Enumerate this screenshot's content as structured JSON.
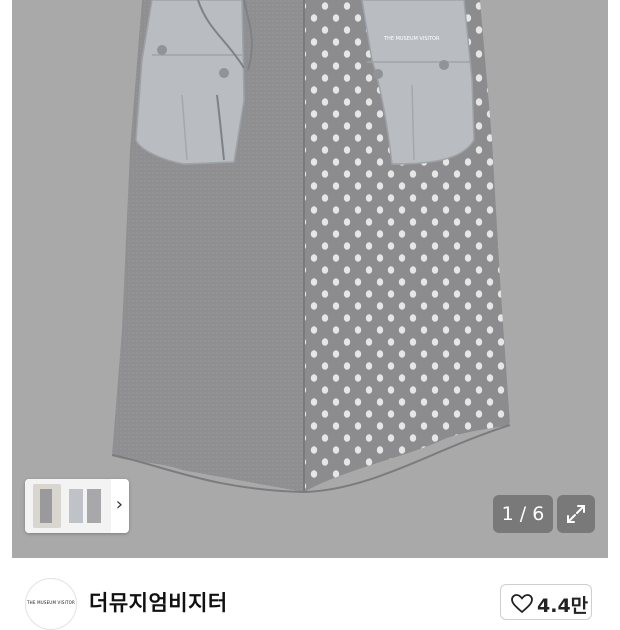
{
  "gallery": {
    "counter": "1 / 6",
    "photo_icon": "product-photo",
    "brand_print": "THE MUSEUM VISITOR"
  },
  "seller": {
    "name": "더뮤지엄비지터",
    "avatar_text": "THE MUSEUM VISITOR"
  },
  "like": {
    "count": "4.4만",
    "icon": "heart-outline-icon"
  }
}
